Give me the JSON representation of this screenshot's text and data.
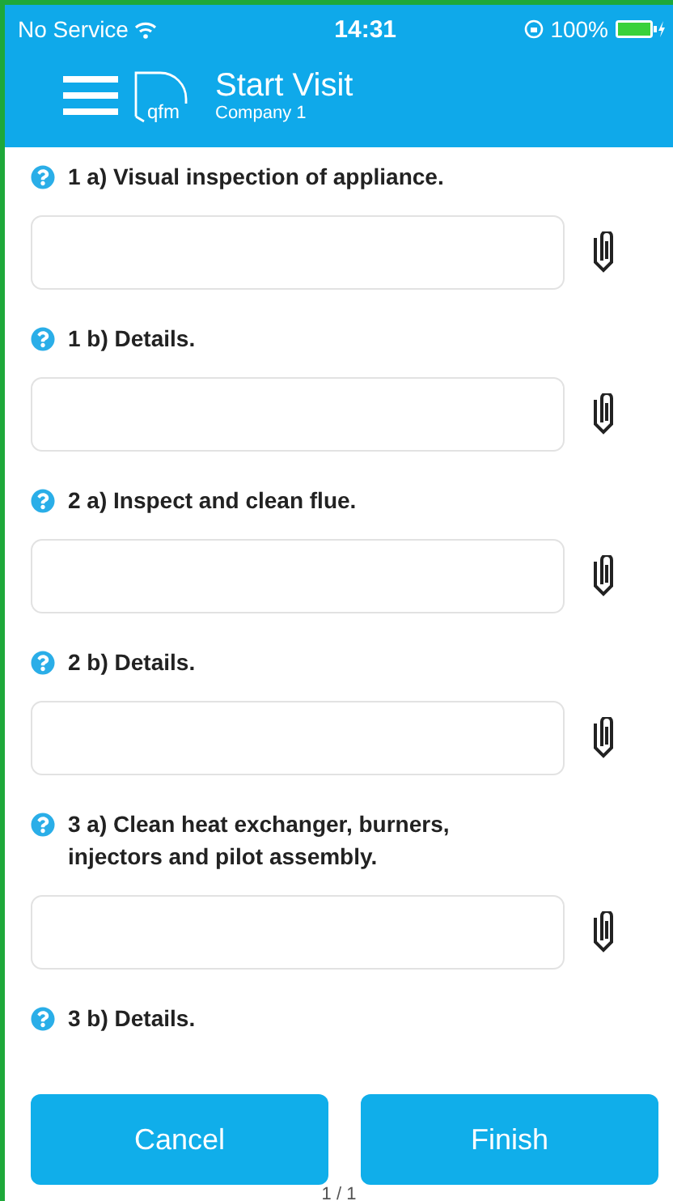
{
  "status_bar": {
    "carrier": "No Service",
    "time": "14:31",
    "battery": "100%"
  },
  "header": {
    "logo_text": "qfm",
    "title": "Start Visit",
    "subtitle": "Company 1"
  },
  "questions": [
    {
      "label": "1 a) Visual inspection of appliance."
    },
    {
      "label": "1 b) Details."
    },
    {
      "label": "2 a) Inspect and clean flue."
    },
    {
      "label": "2 b) Details."
    },
    {
      "label": "3 a) Clean heat exchanger, burners, injectors and pilot assembly."
    }
  ],
  "last_question": {
    "label": "3 b) Details."
  },
  "buttons": [
    "Cancel",
    "Finish"
  ],
  "page_indicator": "1 / 1"
}
